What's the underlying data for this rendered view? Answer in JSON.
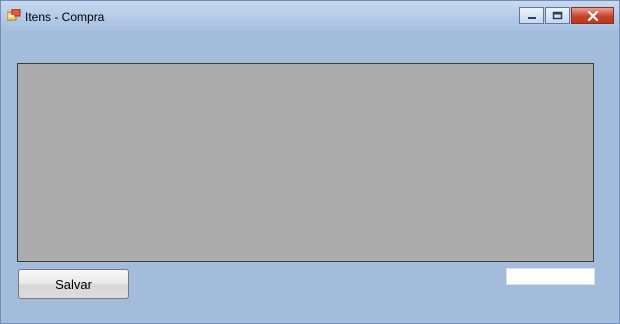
{
  "window": {
    "title": "Itens - Compra",
    "icon": "app-form-icon",
    "controls": [
      "minimize-icon",
      "maximize-icon",
      "close-icon"
    ]
  },
  "grid": {
    "rows": []
  },
  "footer": {
    "save_label": "Salvar",
    "total_value": ""
  },
  "colors": {
    "background": "#a3bcdb",
    "grid_background": "#acacac",
    "close_button": "#c7432b"
  }
}
